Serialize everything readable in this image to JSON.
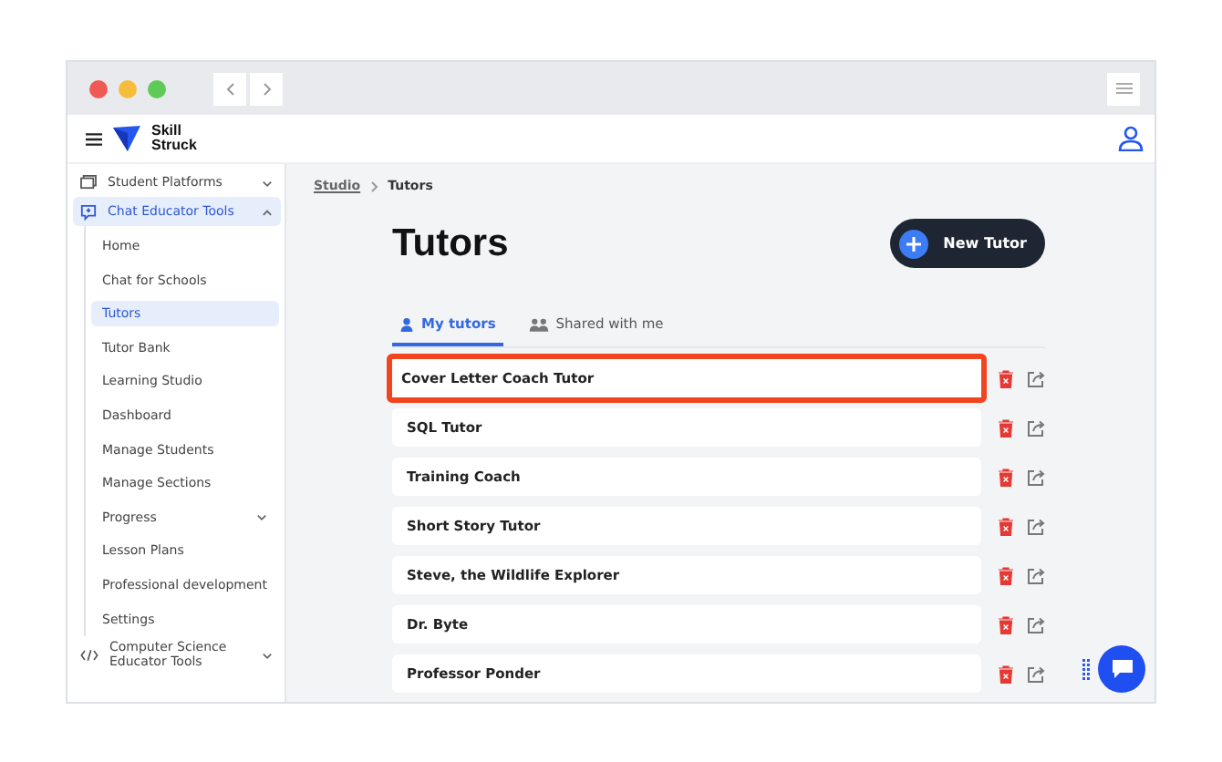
{
  "breadcrumb": [
    {
      "label": "Studio"
    },
    {
      "label": "Tutors"
    }
  ],
  "brand": {
    "line1": "Skill",
    "line2": "Struck"
  },
  "sidebar": {
    "items": [
      {
        "label": "Student Platforms",
        "expanded": false,
        "selected": false
      },
      {
        "label": "Chat Educator Tools",
        "expanded": true,
        "selected": true,
        "children": [
          {
            "label": "Home",
            "selected": false
          },
          {
            "label": "Chat for Schools",
            "selected": false
          },
          {
            "label": "Tutors",
            "selected": true
          },
          {
            "label": "Tutor Bank",
            "selected": false
          },
          {
            "label": "Learning Studio",
            "selected": false
          },
          {
            "label": "Dashboard",
            "selected": false
          },
          {
            "label": "Manage Students",
            "selected": false
          },
          {
            "label": "Manage Sections",
            "selected": false
          },
          {
            "label": "Progress",
            "selected": false,
            "expanded": false
          },
          {
            "label": "Lesson Plans",
            "selected": false
          },
          {
            "label": "Professional development",
            "selected": false
          },
          {
            "label": "Settings",
            "selected": false
          }
        ]
      },
      {
        "label": "Computer Science Educator Tools",
        "expanded": false,
        "selected": false
      }
    ]
  },
  "page": {
    "title": "Tutors",
    "new_button": "New Tutor"
  },
  "tabs": [
    {
      "label": "My tutors",
      "selected": true
    },
    {
      "label": "Shared with me",
      "selected": false
    }
  ],
  "tutors": [
    {
      "name": "Cover Letter Coach Tutor",
      "highlighted": true
    },
    {
      "name": "SQL Tutor",
      "highlighted": false
    },
    {
      "name": "Training Coach",
      "highlighted": false
    },
    {
      "name": "Short Story Tutor",
      "highlighted": false
    },
    {
      "name": "Steve, the Wildlife Explorer",
      "highlighted": false
    },
    {
      "name": "Dr. Byte",
      "highlighted": false
    },
    {
      "name": "Professor Ponder",
      "highlighted": false
    }
  ]
}
